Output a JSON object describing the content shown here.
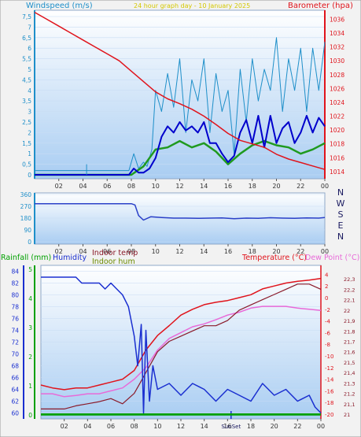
{
  "header": {
    "windspeed_label": "Windspeed (m/s)",
    "period_label": "24 hour graph day - 10 January 2025",
    "barometer_label": "Barometer (hpa)"
  },
  "colors": {
    "background": "#F2F2F2",
    "plot_top": "#FFFFFF",
    "plot_bottom": "#A9CDF2",
    "grid": "#C8DCF4",
    "wind_avg": "#1E8FC9",
    "wind_gust": "#0000CC",
    "wind_dir_green": "#1F9A1F",
    "barometer": "#E0141C",
    "axis_left": "#1E8FC9",
    "axis_right": "#E0141C",
    "direction": "#2A40C8",
    "rainfall": "#00A000",
    "humidity": "#1A2FD0",
    "indoor_temp": "#8A1A2A",
    "indoor_hum": "#6A8A00",
    "temperature": "#E0141C",
    "dew_point": "#E86AD8"
  },
  "chart_data": [
    {
      "type": "line",
      "title": "Windspeed / Barometer",
      "x_ticks": [
        "02",
        "04",
        "06",
        "08",
        "10",
        "12",
        "14",
        "16",
        "18",
        "20",
        "22",
        "00"
      ],
      "xlim": [
        0,
        24
      ],
      "left_axis": {
        "label": "Windspeed (m/s)",
        "ylim": [
          0,
          7.5
        ],
        "ticks": [
          "0",
          "0,5",
          "1",
          "1,5",
          "2",
          "2,5",
          "3",
          "3,5",
          "4",
          "4,5",
          "5",
          "5,5",
          "6",
          "6,5",
          "7",
          "7,5"
        ]
      },
      "right_axis": {
        "label": "Barometer (hpa)",
        "ylim": [
          1013.3,
          1037.3
        ],
        "ticks": [
          "1014",
          "1016",
          "1018",
          "1020",
          "1022",
          "1024",
          "1026",
          "1028",
          "1030",
          "1032",
          "1034",
          "1036"
        ]
      },
      "series": [
        {
          "name": "Barometer (hpa)",
          "axis": "right",
          "x": [
            0,
            1,
            2,
            3,
            4,
            5,
            6,
            7,
            8,
            9,
            10,
            11,
            12,
            13,
            14,
            15,
            16,
            17,
            18,
            19,
            20,
            21,
            22,
            23,
            24
          ],
          "values": [
            1037,
            1036,
            1035,
            1034,
            1033,
            1032,
            1031,
            1030,
            1028.5,
            1027,
            1025.5,
            1024.5,
            1023.8,
            1023,
            1022,
            1020.8,
            1019.5,
            1018.5,
            1018,
            1017.5,
            1016.5,
            1015.8,
            1015.3,
            1014.8,
            1014.3
          ]
        },
        {
          "name": "Wind gust",
          "axis": "left",
          "x": [
            0,
            1,
            2,
            3,
            4,
            5,
            6,
            7,
            7.8,
            8.2,
            8.6,
            9,
            9.3,
            9.7,
            10,
            10.5,
            11,
            11.5,
            12,
            12.5,
            13,
            13.5,
            14,
            14.5,
            15,
            15.5,
            16,
            16.5,
            17,
            17.5,
            18,
            18.5,
            19,
            19.5,
            20,
            20.5,
            21,
            21.5,
            22,
            22.5,
            23,
            23.5,
            24
          ],
          "values": [
            0.2,
            0.2,
            0.2,
            0.2,
            0.2,
            0.2,
            0.2,
            0.2,
            0.2,
            1.0,
            0.3,
            0.6,
            0.4,
            1.2,
            4.0,
            3.0,
            4.8,
            3.2,
            5.5,
            2.0,
            4.5,
            3.5,
            5.5,
            2.0,
            4.8,
            3.0,
            4.0,
            1.0,
            5.0,
            2.5,
            5.5,
            3.5,
            5.0,
            4.0,
            6.5,
            3.0,
            5.5,
            4.0,
            6.0,
            3.0,
            6.0,
            4.0,
            6.3
          ]
        },
        {
          "name": "Wind average",
          "axis": "left",
          "x": [
            0,
            1,
            2,
            3,
            4,
            5,
            6,
            7,
            7.8,
            8.2,
            8.6,
            9,
            9.5,
            10,
            10.5,
            11,
            11.5,
            12,
            12.5,
            13,
            13.5,
            14,
            14.5,
            15,
            15.5,
            16,
            16.5,
            17,
            17.5,
            18,
            18.5,
            19,
            19.5,
            20,
            20.5,
            21,
            21.5,
            22,
            22.5,
            23,
            23.5,
            24
          ],
          "values": [
            0,
            0,
            0,
            0,
            0,
            0,
            0,
            0,
            0,
            0.3,
            0.1,
            0.1,
            0.3,
            0.8,
            1.8,
            2.3,
            2.0,
            2.5,
            2.1,
            2.3,
            2.0,
            2.5,
            1.5,
            1.5,
            1.0,
            0.6,
            0.9,
            2.0,
            2.6,
            1.5,
            2.8,
            1.3,
            2.8,
            1.5,
            2.2,
            2.5,
            1.5,
            2.0,
            2.8,
            2.0,
            2.7,
            2.3
          ]
        },
        {
          "name": "Wind direction band",
          "axis": "left",
          "x": [
            0,
            8,
            9,
            10,
            11,
            12,
            13,
            14,
            15,
            16,
            17,
            18,
            19,
            20,
            21,
            22,
            23,
            24
          ],
          "values": [
            0,
            0,
            0.4,
            1.2,
            1.3,
            1.6,
            1.3,
            1.5,
            1.1,
            0.5,
            1.0,
            1.4,
            1.6,
            1.4,
            1.3,
            1.0,
            1.2,
            1.5
          ]
        }
      ],
      "spike": {
        "x": 4.3,
        "value": 0.5
      }
    },
    {
      "type": "line",
      "title": "Wind direction",
      "x_ticks": [
        "02",
        "04",
        "06",
        "08",
        "10",
        "12",
        "14",
        "16",
        "18",
        "20",
        "22",
        "00"
      ],
      "xlim": [
        0,
        24
      ],
      "left_axis": {
        "ylim": [
          0,
          360
        ],
        "ticks": [
          "0",
          "90",
          "180",
          "270",
          "360"
        ]
      },
      "compass_labels": [
        "N",
        "W",
        "S",
        "E",
        "N"
      ],
      "series": [
        {
          "name": "Direction",
          "x": [
            0,
            2,
            4,
            6,
            7.5,
            8.0,
            8.3,
            8.6,
            9.0,
            9.6,
            10.5,
            11.5,
            12.5,
            13.5,
            14.5,
            15.5,
            16.5,
            17.5,
            18.5,
            19.5,
            20.5,
            21.5,
            22.5,
            23.5,
            24
          ],
          "values": [
            290,
            290,
            290,
            290,
            290,
            290,
            280,
            200,
            165,
            190,
            185,
            180,
            180,
            178,
            180,
            182,
            176,
            180,
            179,
            183,
            180,
            178,
            182,
            180,
            184
          ]
        }
      ]
    },
    {
      "type": "line",
      "title": "Rainfall / Humidity / Temperature",
      "x_ticks": [
        "02",
        "04",
        "06",
        "08",
        "10",
        "12",
        "14",
        "16",
        "18",
        "20",
        "22",
        "00"
      ],
      "xlim": [
        0,
        24
      ],
      "annotations": [
        "SunSet"
      ],
      "legend": [
        "Rainfall (mm)",
        "Humidity",
        "Indoor temp",
        "Indoor hum",
        "Temperature (°C)",
        "Dew Point (°C)"
      ],
      "rainfall_axis": {
        "ylim": [
          0,
          5
        ],
        "ticks": [
          "0",
          "1",
          "2",
          "3",
          "4",
          "5"
        ]
      },
      "humidity_axis": {
        "ylim": [
          59,
          85
        ],
        "ticks": [
          "60",
          "62",
          "64",
          "66",
          "68",
          "70",
          "72",
          "74",
          "76",
          "78",
          "80",
          "82",
          "84"
        ]
      },
      "temperature_axis": {
        "ylim": [
          -20,
          5
        ],
        "ticks": [
          "-20",
          "-18",
          "-16",
          "-14",
          "-12",
          "-10",
          "-8",
          "-6",
          "-4",
          "-2",
          "0",
          "2",
          "4"
        ]
      },
      "indoor_axis": {
        "ylim": [
          21.0,
          22.4
        ],
        "ticks": [
          "21",
          "21,1",
          "21,2",
          "21,3",
          "21,4",
          "21,5",
          "21,6",
          "21,7",
          "21,8",
          "21,9",
          "22",
          "22,1",
          "22,2",
          "22,3"
        ]
      },
      "series": [
        {
          "name": "Rainfall (mm)",
          "axis": "rainfall",
          "x": [
            0,
            24
          ],
          "values": [
            0,
            0
          ]
        },
        {
          "name": "Humidity",
          "axis": "humidity",
          "x": [
            0,
            3,
            3.5,
            5,
            5.5,
            6,
            6.5,
            7,
            7.5,
            8,
            8.3,
            8.6,
            8.8,
            9,
            9.3,
            9.6,
            10,
            11,
            12,
            13,
            14,
            15,
            16,
            17,
            18,
            19,
            20,
            21,
            22,
            23,
            23.5,
            24
          ],
          "values": [
            83,
            83,
            82,
            82,
            81,
            82,
            81,
            80,
            78,
            73,
            68,
            75,
            60,
            74,
            62,
            68,
            64,
            65,
            63,
            65,
            64,
            62,
            64,
            63,
            62,
            65,
            63,
            64,
            62,
            63,
            61,
            60
          ]
        },
        {
          "name": "Temperature (°C)",
          "axis": "temperature",
          "x": [
            0,
            1,
            2,
            3,
            4,
            5,
            6,
            7,
            8,
            9,
            10,
            11,
            12,
            13,
            14,
            15,
            16,
            17,
            18,
            19,
            20,
            21,
            22,
            23,
            24
          ],
          "values": [
            -15,
            -15.5,
            -15.8,
            -15.5,
            -15.5,
            -15.0,
            -14.5,
            -14.0,
            -12.5,
            -9.0,
            -6.5,
            -4.8,
            -3.0,
            -2.0,
            -1.2,
            -0.8,
            -0.5,
            0.0,
            0.5,
            1.5,
            2.0,
            2.5,
            2.8,
            3.0,
            3.3
          ]
        },
        {
          "name": "Dew Point (°C)",
          "axis": "temperature",
          "x": [
            0,
            1,
            2,
            3,
            4,
            5,
            6,
            7,
            8,
            9,
            10,
            11,
            12,
            13,
            14,
            15,
            16,
            17,
            18,
            19,
            20,
            21,
            22,
            23,
            24
          ],
          "values": [
            -16.5,
            -16.5,
            -17.0,
            -16.8,
            -16.5,
            -16.5,
            -16.0,
            -15.5,
            -14.0,
            -12.0,
            -9.0,
            -7.0,
            -6.0,
            -5.0,
            -4.5,
            -3.8,
            -3.0,
            -2.5,
            -1.8,
            -1.5,
            -1.5,
            -1.5,
            -1.8,
            -2.0,
            -2.2
          ]
        },
        {
          "name": "Indoor temp",
          "axis": "indoor",
          "x": [
            0,
            2,
            3,
            4,
            5,
            6,
            7,
            8,
            8.5,
            9,
            9.5,
            10,
            11,
            12,
            13,
            14,
            15,
            16,
            17,
            18,
            19,
            20,
            21,
            22,
            23,
            24
          ],
          "values": [
            21.05,
            21.05,
            21.08,
            21.1,
            21.12,
            21.15,
            21.1,
            21.2,
            21.3,
            21.4,
            21.5,
            21.6,
            21.7,
            21.75,
            21.8,
            21.85,
            21.85,
            21.9,
            22.0,
            22.05,
            22.1,
            22.15,
            22.2,
            22.25,
            22.25,
            22.2
          ]
        },
        {
          "name": "Indoor hum",
          "axis": "indoor",
          "x": [
            0,
            24
          ],
          "values": [
            21.0,
            21.0
          ]
        }
      ]
    }
  ]
}
